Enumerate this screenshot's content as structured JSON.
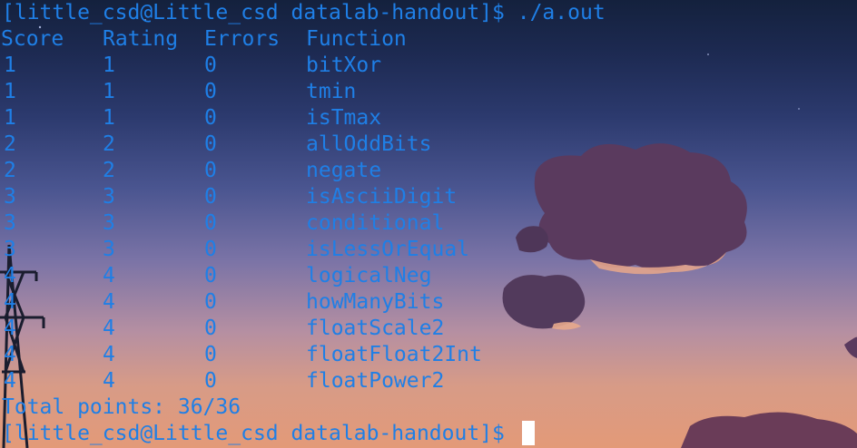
{
  "terminal": {
    "command_prompt": "[little_csd@Little_csd datalab-handout]$ ./a.out",
    "headers": {
      "score": "Score",
      "rating": "Rating",
      "errors": "Errors",
      "function": "Function"
    },
    "rows": [
      {
        "score": "1",
        "rating": "1",
        "errors": "0",
        "function": "bitXor"
      },
      {
        "score": "1",
        "rating": "1",
        "errors": "0",
        "function": "tmin"
      },
      {
        "score": "1",
        "rating": "1",
        "errors": "0",
        "function": "isTmax"
      },
      {
        "score": "2",
        "rating": "2",
        "errors": "0",
        "function": "allOddBits"
      },
      {
        "score": "2",
        "rating": "2",
        "errors": "0",
        "function": "negate"
      },
      {
        "score": "3",
        "rating": "3",
        "errors": "0",
        "function": "isAsciiDigit"
      },
      {
        "score": "3",
        "rating": "3",
        "errors": "0",
        "function": "conditional"
      },
      {
        "score": "3",
        "rating": "3",
        "errors": "0",
        "function": "isLessOrEqual"
      },
      {
        "score": "4",
        "rating": "4",
        "errors": "0",
        "function": "logicalNeg"
      },
      {
        "score": "4",
        "rating": "4",
        "errors": "0",
        "function": "howManyBits"
      },
      {
        "score": "4",
        "rating": "4",
        "errors": "0",
        "function": "floatScale2"
      },
      {
        "score": "4",
        "rating": "4",
        "errors": "0",
        "function": "floatFloat2Int"
      },
      {
        "score": "4",
        "rating": "4",
        "errors": "0",
        "function": "floatPower2"
      }
    ],
    "total": "Total points: 36/36",
    "final_prompt": "[little_csd@Little_csd datalab-handout]$",
    "text_color": "#1f7fe6",
    "cursor_color": "#ffffff"
  }
}
